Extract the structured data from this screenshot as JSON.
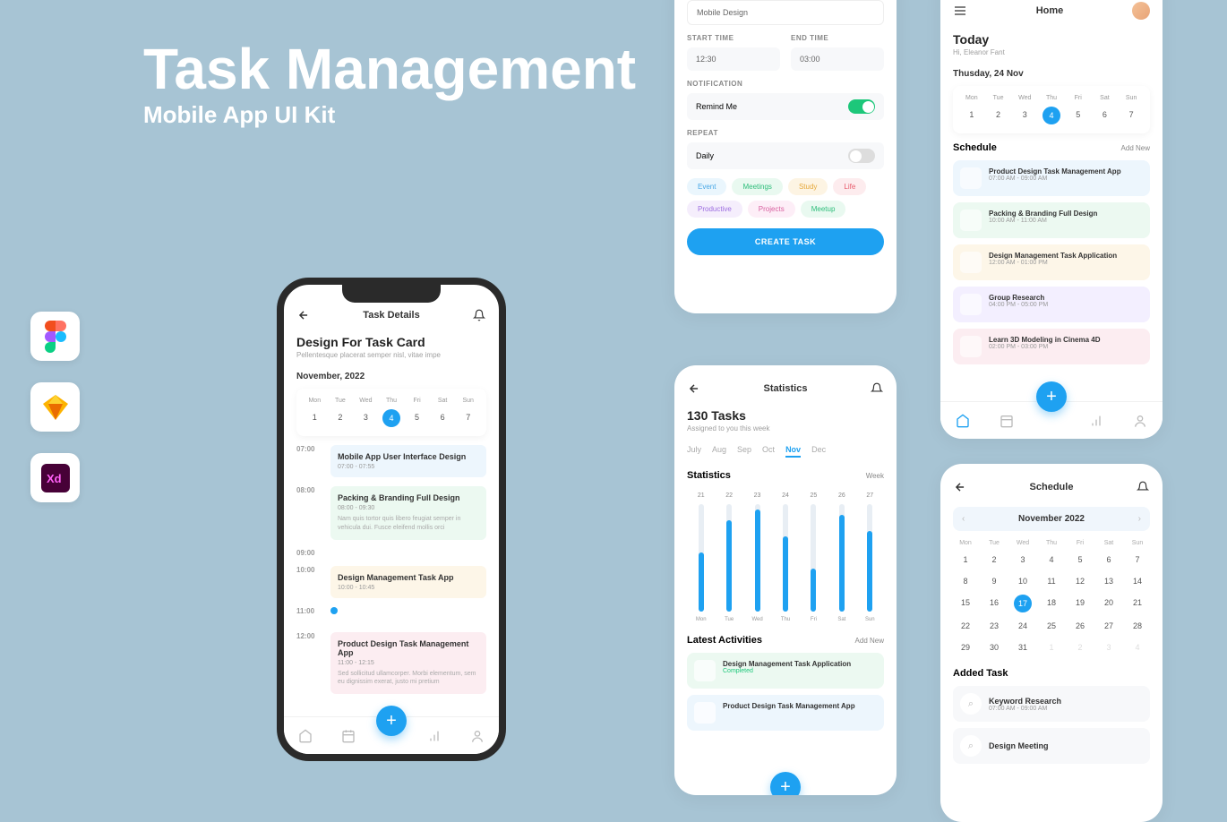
{
  "hero": {
    "title": "Task Management",
    "subtitle": "Mobile App UI Kit"
  },
  "tools": [
    "figma",
    "sketch",
    "xd"
  ],
  "phone": {
    "header": "Task Details",
    "title": "Design For Task Card",
    "sub": "Pellentesque placerat semper nisl, vitae impe",
    "month": "November, 2022",
    "week": {
      "days": [
        "Mon",
        "Tue",
        "Wed",
        "Thu",
        "Fri",
        "Sat",
        "Sun"
      ],
      "nums": [
        1,
        2,
        3,
        4,
        5,
        6,
        7
      ],
      "active": 4
    },
    "tasks": [
      {
        "time": "07:00",
        "title": "Mobile App User Interface Design",
        "sub": "07:00 - 07:55",
        "cls": "bg-blue"
      },
      {
        "time": "08:00",
        "title": "Packing & Branding Full Design",
        "sub": "08:00 - 09:30",
        "desc": "Nam quis tortor quis libero feugiat semper in vehicula dui. Fusce eleifend mollis orci",
        "cls": "bg-green"
      },
      {
        "time": "09:00"
      },
      {
        "time": "10:00",
        "title": "Design Management Task App",
        "sub": "10:00 - 10:45",
        "cls": "bg-yellow"
      },
      {
        "time": "11:00",
        "timeline": true
      },
      {
        "time": "12:00",
        "title": "Product Design Task Management App",
        "sub": "11:00 - 12:15",
        "desc": "Sed sollicitud ullamcorper. Morbi elementum, sem eu dignissim exerat, justo mi pretium",
        "cls": "bg-pink"
      }
    ]
  },
  "create": {
    "name_label": "",
    "name_value": "Mobile Design",
    "start_label": "START TIME",
    "start_value": "12:30",
    "end_label": "END TIME",
    "end_value": "03:00",
    "notif_label": "NOTIFICATION",
    "remind": "Remind Me",
    "repeat_label": "REPEAT",
    "repeat_value": "Daily",
    "tags": [
      {
        "t": "Event",
        "bg": "#eaf6fd",
        "c": "#4aa8e6"
      },
      {
        "t": "Meetings",
        "bg": "#e9f9f0",
        "c": "#2dbd7a"
      },
      {
        "t": "Study",
        "bg": "#fdf4e3",
        "c": "#e6a93d"
      },
      {
        "t": "Life",
        "bg": "#fdecee",
        "c": "#e85a6b"
      },
      {
        "t": "Productive",
        "bg": "#f5eefc",
        "c": "#9c6de0"
      },
      {
        "t": "Projects",
        "bg": "#fdeef7",
        "c": "#d8609f"
      },
      {
        "t": "Meetup",
        "bg": "#e9f9f0",
        "c": "#2dbd7a"
      }
    ],
    "cta": "CREATE TASK"
  },
  "home": {
    "header": "Home",
    "today": "Today",
    "greet": "Hi, Eleanor Fant",
    "date": "Thusday, 24 Nov",
    "week": {
      "days": [
        "Mon",
        "Tue",
        "Wed",
        "Thu",
        "Fri",
        "Sat",
        "Sun"
      ],
      "nums": [
        1,
        2,
        3,
        4,
        5,
        6,
        7
      ],
      "active": 4
    },
    "sched_label": "Schedule",
    "add": "Add New",
    "items": [
      {
        "t": "Product Design Task Management App",
        "s": "07:00 AM - 09:00 AM",
        "cls": "bg-blue"
      },
      {
        "t": "Packing & Branding Full Design",
        "s": "10:00 AM - 11:00 AM",
        "cls": "bg-green"
      },
      {
        "t": "Design Management Task  Application",
        "s": "12:00 AM - 01:00 PM",
        "cls": "bg-yellow"
      },
      {
        "t": "Group Research",
        "s": "04:00 PM - 05:00 PM",
        "cls": "bg-purple"
      },
      {
        "t": "Learn 3D Modeling in Cinema 4D",
        "s": "02:00 PM - 03:00 PM",
        "cls": "bg-pink"
      }
    ]
  },
  "stats": {
    "header": "Statistics",
    "count": "130 Tasks",
    "sub": "Assigned to you this week",
    "months": [
      "July",
      "Aug",
      "Sep",
      "Oct",
      "Nov",
      "Dec"
    ],
    "active_month": "Nov",
    "sec_label": "Statistics",
    "period": "Week",
    "latest_label": "Latest Activities",
    "add": "Add New",
    "activities": [
      {
        "t": "Design Management Task Application",
        "st": "Completed",
        "cls": "bg-green",
        "stc": "st-done"
      },
      {
        "t": "Product Design Task Management App",
        "st": "",
        "cls": "bg-blue"
      }
    ]
  },
  "chart_data": {
    "type": "bar",
    "categories_top": [
      "21",
      "22",
      "23",
      "24",
      "25",
      "26",
      "27"
    ],
    "categories_bottom": [
      "Mon",
      "Tue",
      "Wed",
      "Thu",
      "Fri",
      "Sat",
      "Sun"
    ],
    "values": [
      55,
      85,
      95,
      70,
      40,
      90,
      75
    ],
    "ylim": [
      0,
      100
    ]
  },
  "schedule": {
    "header": "Schedule",
    "month": "November 2022",
    "dow": [
      "Mon",
      "Tue",
      "Wed",
      "Thu",
      "Fri",
      "Sat",
      "Sun"
    ],
    "days": [
      1,
      2,
      3,
      4,
      5,
      6,
      7,
      8,
      9,
      10,
      11,
      12,
      13,
      14,
      15,
      16,
      17,
      18,
      19,
      20,
      21,
      22,
      23,
      24,
      25,
      26,
      27,
      28,
      29,
      30,
      31
    ],
    "trail": [
      1,
      2,
      3,
      4
    ],
    "active": 17,
    "added_label": "Added Task",
    "items": [
      {
        "t": "Keyword Research",
        "s": "07:00 AM - 09:00 AM"
      },
      {
        "t": "Design Meeting",
        "s": ""
      }
    ]
  }
}
